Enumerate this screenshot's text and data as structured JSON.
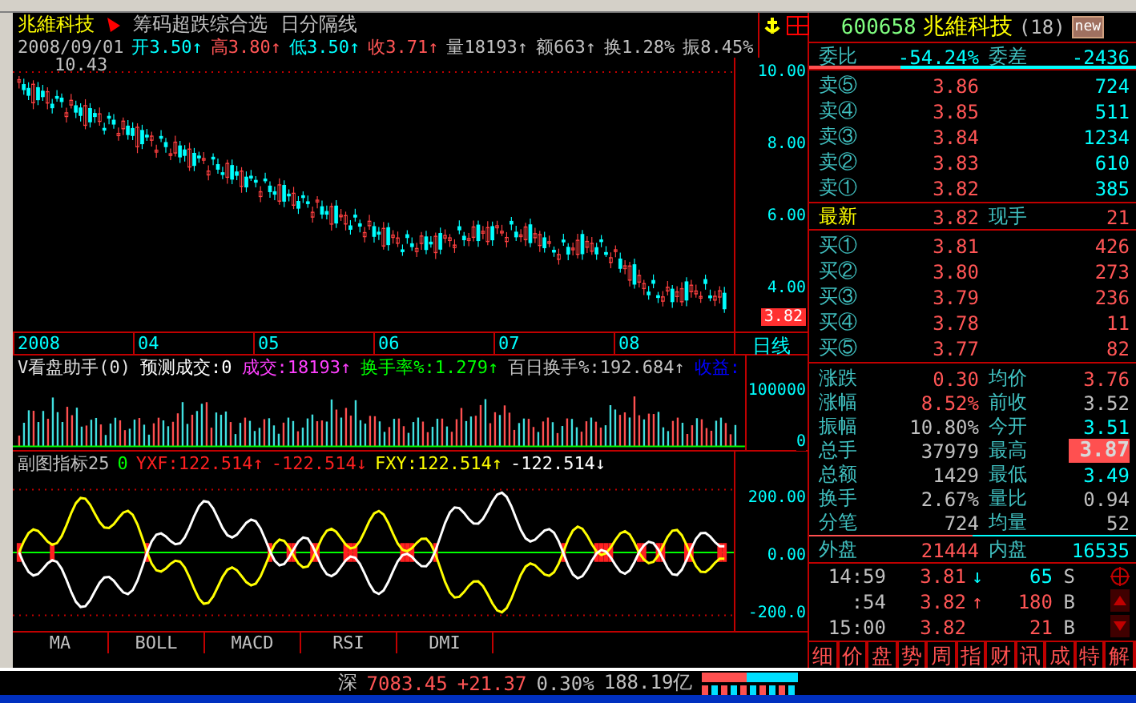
{
  "header": {
    "stock_name": "兆維科技",
    "title": "筹码超跌综合选",
    "period": "日分隔线"
  },
  "quote_line": [
    {
      "text": "2008/09/01",
      "color": "#c0c0c0"
    },
    {
      "text": "开3.50",
      "arrow": "↑",
      "color": "#00ffff"
    },
    {
      "text": "高3.80",
      "arrow": "↑",
      "color": "#ff5555"
    },
    {
      "text": "低3.50",
      "arrow": "↑",
      "color": "#00ffff"
    },
    {
      "text": "收3.71",
      "arrow": "↑",
      "color": "#ff5555"
    },
    {
      "text": "量18193",
      "arrow": "↑",
      "color": "#c0c0c0"
    },
    {
      "text": "额663",
      "arrow": "↑",
      "color": "#c0c0c0"
    },
    {
      "text": "换1.28%",
      "color": "#c0c0c0"
    },
    {
      "text": "振8.45%",
      "color": "#c0c0c0"
    }
  ],
  "price_chart": {
    "high_label": "10.43",
    "axis_labels": [
      "10.00",
      "8.00",
      "6.00",
      "4.00"
    ],
    "current_price": "3.82"
  },
  "date_axis": {
    "labels": [
      "2008",
      "04",
      "05",
      "06",
      "07",
      "08"
    ],
    "period": "日线"
  },
  "volume_panel": {
    "items": [
      {
        "text": "V看盘助手(0)",
        "color": "#e0e0e0"
      },
      {
        "text": "预测成交:0",
        "color": "#ffffff"
      },
      {
        "text": "成交:18193↑",
        "color": "#ff40ff"
      },
      {
        "text": "换手率%:1.279↑",
        "color": "#00ff00"
      },
      {
        "text": "百日换手%:192.684↑",
        "color": "#c0c0c0"
      },
      {
        "text": "收益:",
        "color": "#0000ff"
      }
    ],
    "axis_labels": [
      "100000",
      "0"
    ]
  },
  "indicator_panel": {
    "items": [
      {
        "text": "副图指标25",
        "color": "#c0c0c0"
      },
      {
        "text": "0",
        "color": "#00ff00"
      },
      {
        "text": "YXF:122.514↑",
        "color": "#ff2020"
      },
      {
        "text": "-122.514↓",
        "color": "#ff2020"
      },
      {
        "text": "FXY:122.514↑",
        "color": "#ffff00"
      },
      {
        "text": "-122.514↓",
        "color": "#ffffff"
      }
    ],
    "axis_labels": [
      "200.00",
      "0.00",
      "-200.0"
    ]
  },
  "indicator_tabs": [
    "MA",
    "BOLL",
    "MACD",
    "RSI",
    "DMI"
  ],
  "quote_panel": {
    "code": "600658",
    "name": "兆維科技",
    "count": "(18)",
    "badge": "new",
    "ratio": {
      "label": "委比",
      "value": "-54.24%",
      "label2": "委差",
      "value2": "-2436"
    },
    "asks": [
      {
        "label": "卖⑤",
        "price": "3.86",
        "volume": "724"
      },
      {
        "label": "卖④",
        "price": "3.85",
        "volume": "511"
      },
      {
        "label": "卖③",
        "price": "3.84",
        "volume": "1234"
      },
      {
        "label": "卖②",
        "price": "3.83",
        "volume": "610"
      },
      {
        "label": "卖①",
        "price": "3.82",
        "volume": "385"
      }
    ],
    "latest": {
      "label": "最新",
      "price": "3.82",
      "label2": "现手",
      "value2": "21"
    },
    "bids": [
      {
        "label": "买①",
        "price": "3.81",
        "volume": "426"
      },
      {
        "label": "买②",
        "price": "3.80",
        "volume": "273"
      },
      {
        "label": "买③",
        "price": "3.79",
        "volume": "236"
      },
      {
        "label": "买④",
        "price": "3.78",
        "volume": "11"
      },
      {
        "label": "买⑤",
        "price": "3.77",
        "volume": "82"
      }
    ],
    "stats": [
      {
        "left": {
          "label": "涨跌",
          "value": "0.30",
          "color": "#ff5555"
        },
        "right": {
          "label": "均价",
          "value": "3.76",
          "color": "#ff5555",
          "highlighted": false
        }
      },
      {
        "left": {
          "label": "涨幅",
          "value": "8.52%",
          "color": "#ff5555"
        },
        "right": {
          "label": "前收",
          "value": "3.52",
          "color": "#c0c0c0",
          "highlighted": false
        }
      },
      {
        "left": {
          "label": "振幅",
          "value": "10.80%",
          "color": "#c0c0c0"
        },
        "right": {
          "label": "今开",
          "value": "3.51",
          "color": "#00ffff",
          "highlighted": false
        }
      },
      {
        "left": {
          "label": "总手",
          "value": "37979",
          "color": "#c0c0c0"
        },
        "right": {
          "label": "最高",
          "value": "3.87",
          "highlighted": true
        }
      },
      {
        "left": {
          "label": "总额",
          "value": "1429",
          "color": "#c0c0c0"
        },
        "right": {
          "label": "最低",
          "value": "3.49",
          "color": "#00ffff",
          "highlighted": false
        }
      },
      {
        "left": {
          "label": "换手",
          "value": "2.67%",
          "color": "#c0c0c0"
        },
        "right": {
          "label": "量比",
          "value": "0.94",
          "color": "#c0c0c0",
          "highlighted": false
        }
      },
      {
        "left": {
          "label": "分笔",
          "value": "724",
          "color": "#c0c0c0"
        },
        "right": {
          "label": "均量",
          "value": "52",
          "color": "#c0c0c0",
          "highlighted": false
        }
      }
    ],
    "outer": {
      "label": "外盘",
      "value": "21444",
      "label2": "内盘",
      "value2": "16535"
    },
    "ticks": [
      {
        "time": "14:59",
        "price": "3.81",
        "arrow": "↓",
        "volume": "65",
        "side": "S"
      },
      {
        "time": ":54",
        "price": "3.82",
        "arrow": "↑",
        "volume": "180",
        "side": "B"
      },
      {
        "time": "15:00",
        "price": "3.82",
        "volume": "21",
        "side": "B"
      }
    ],
    "tabs": [
      "细",
      "价",
      "盘",
      "势",
      "周",
      "指",
      "财",
      "讯",
      "成",
      "特",
      "解"
    ]
  },
  "status_bar": {
    "market": "深",
    "index": "7083.45",
    "change": "+21.37",
    "percent": "0.30%",
    "amount": "188.19亿"
  }
}
